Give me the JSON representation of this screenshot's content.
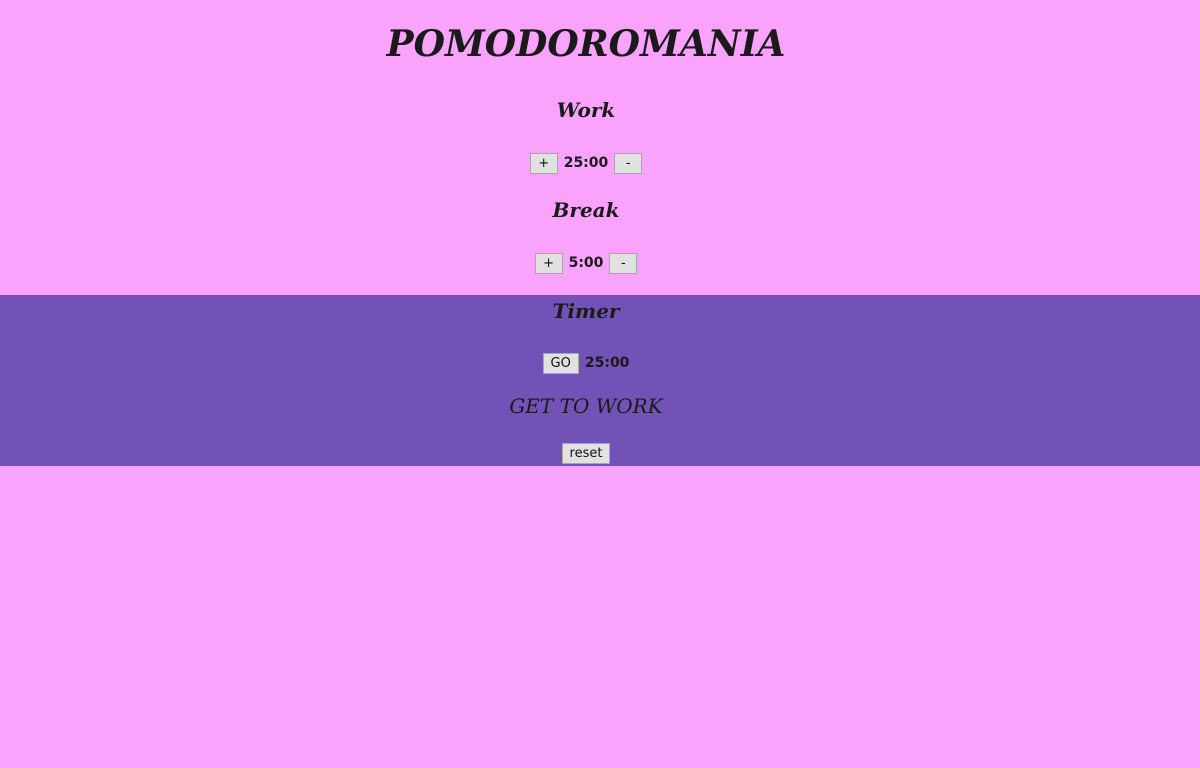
{
  "title": "POMODOROMANIA",
  "work": {
    "heading": "Work",
    "increment_label": "+",
    "value": "25:00",
    "decrement_label": "-"
  },
  "break": {
    "heading": "Break",
    "increment_label": "+",
    "value": "5:00",
    "decrement_label": "-"
  },
  "timer": {
    "heading": "Timer",
    "go_label": "GO",
    "value": "25:00",
    "status": "GET TO WORK",
    "reset_label": "reset"
  },
  "colors": {
    "background": "#f9a3fd",
    "timer_band": "#7352b8",
    "button_bg": "#e1e1e1"
  }
}
